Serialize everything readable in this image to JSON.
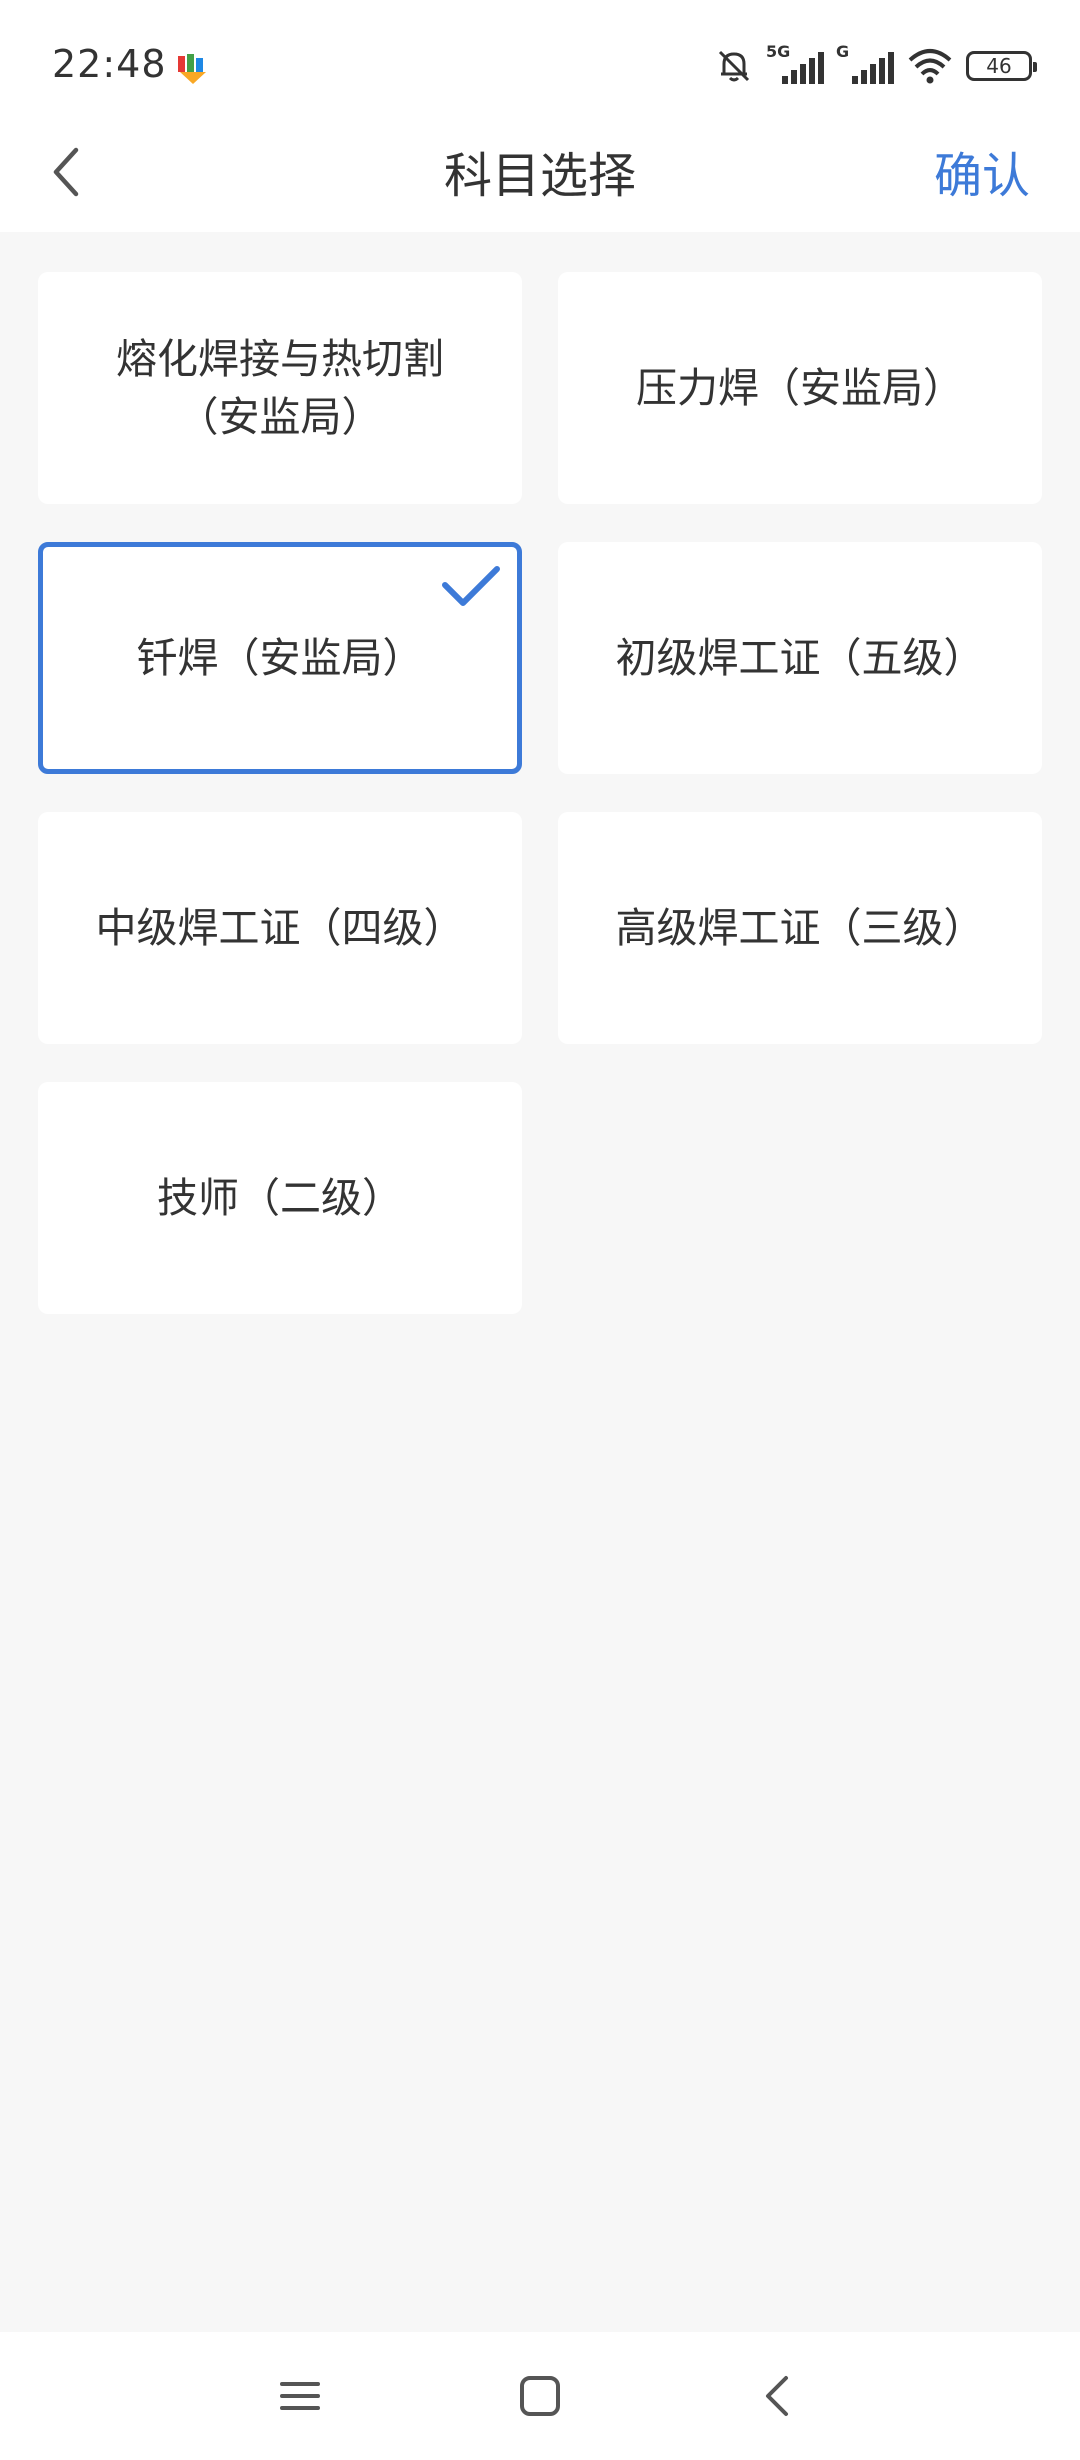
{
  "status_bar": {
    "time": "22:48",
    "battery_level": "46",
    "network_labels": [
      "5G",
      "G"
    ]
  },
  "header": {
    "title": "科目选择",
    "confirm_label": "确认"
  },
  "subjects": [
    {
      "label": "熔化焊接与热切割\n（安监局）",
      "selected": false
    },
    {
      "label": "压力焊（安监局）",
      "selected": false
    },
    {
      "label": "钎焊（安监局）",
      "selected": true
    },
    {
      "label": "初级焊工证（五级）",
      "selected": false
    },
    {
      "label": "中级焊工证（四级）",
      "selected": false
    },
    {
      "label": "高级焊工证（三级）",
      "selected": false
    },
    {
      "label": "技师（二级）",
      "selected": false
    }
  ],
  "colors": {
    "accent": "#3d7ad8",
    "background": "#f7f7f7",
    "card": "#ffffff",
    "text": "#333333"
  },
  "icons": {
    "back": "chevron-left-icon",
    "check": "checkmark-icon",
    "nav_menu": "menu-icon",
    "nav_home": "home-square-icon",
    "nav_back": "back-icon"
  }
}
